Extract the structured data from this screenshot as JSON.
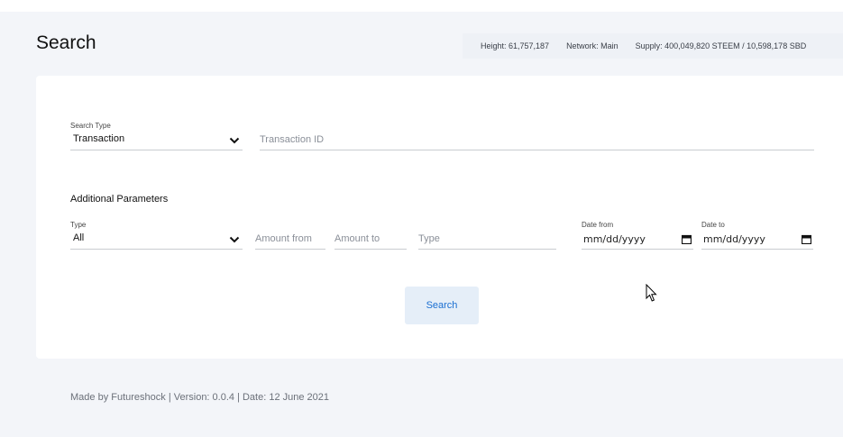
{
  "page": {
    "title": "Search"
  },
  "stats": {
    "height": "Height: 61,757,187",
    "network": "Network: Main",
    "supply": "Supply: 400,049,820 STEEM / 10,598,178 SBD"
  },
  "search_form": {
    "search_type_label": "Search Type",
    "search_type_value": "Transaction",
    "transaction_id_placeholder": "Transaction ID"
  },
  "additional": {
    "title": "Additional Parameters",
    "type_label": "Type",
    "type_value": "All",
    "amount_from_placeholder": "Amount from",
    "amount_to_placeholder": "Amount to",
    "op_type_placeholder": "Type",
    "date_from_label": "Date from",
    "date_from_value": "mm/dd/yyyy",
    "date_to_label": "Date to",
    "date_to_value": "mm/dd/yyyy"
  },
  "buttons": {
    "search": "Search"
  },
  "footer": {
    "text": "Made by Futureshock | Version: 0.0.4 | Date: 12 June 2021"
  },
  "icons": {
    "chevron": "chevron-down-icon",
    "calendar": "calendar-icon",
    "cursor": "mouse-pointer-icon"
  },
  "colors": {
    "background": "#f3f5f9",
    "card": "#ffffff",
    "button_bg": "#e5eef8",
    "button_text": "#1b6fd1"
  }
}
